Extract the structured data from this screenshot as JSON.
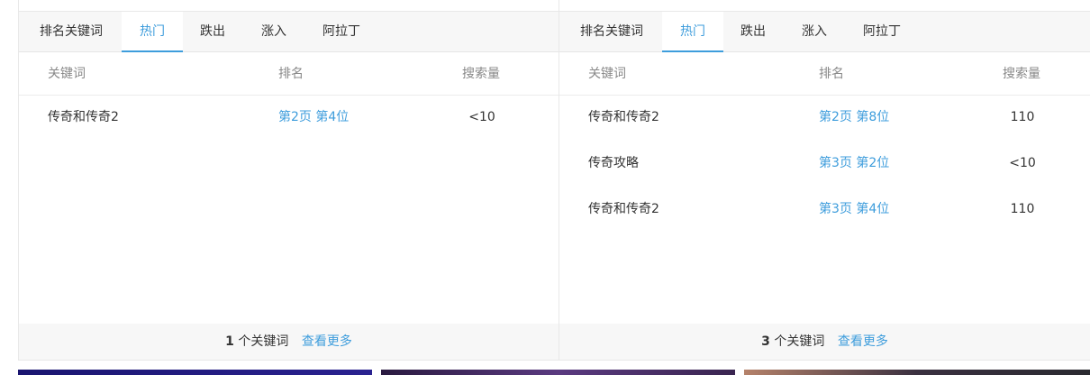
{
  "panels": [
    {
      "tabs": [
        "排名关键词",
        "热门",
        "跌出",
        "涨入",
        "阿拉丁"
      ],
      "active_tab": 1,
      "headers": {
        "keyword": "关键词",
        "rank": "排名",
        "volume": "搜索量"
      },
      "rows": [
        {
          "keyword": "传奇和传奇2",
          "rank": "第2页 第4位",
          "volume": "<10"
        }
      ],
      "footer": {
        "count": "1",
        "count_label": "个关键词",
        "more": "查看更多"
      }
    },
    {
      "tabs": [
        "排名关键词",
        "热门",
        "跌出",
        "涨入",
        "阿拉丁"
      ],
      "active_tab": 1,
      "headers": {
        "keyword": "关键词",
        "rank": "排名",
        "volume": "搜索量"
      },
      "rows": [
        {
          "keyword": "传奇和传奇2",
          "rank": "第2页 第8位",
          "volume": "110"
        },
        {
          "keyword": "传奇攻略",
          "rank": "第3页 第2位",
          "volume": "<10"
        },
        {
          "keyword": "传奇和传奇2",
          "rank": "第3页 第4位",
          "volume": "110"
        }
      ],
      "footer": {
        "count": "3",
        "count_label": "个关键词",
        "more": "查看更多"
      }
    }
  ],
  "colors": {
    "accent": "#3e9ddc",
    "tab_bar": "#f7f7f7",
    "border": "#e8e8e8"
  }
}
